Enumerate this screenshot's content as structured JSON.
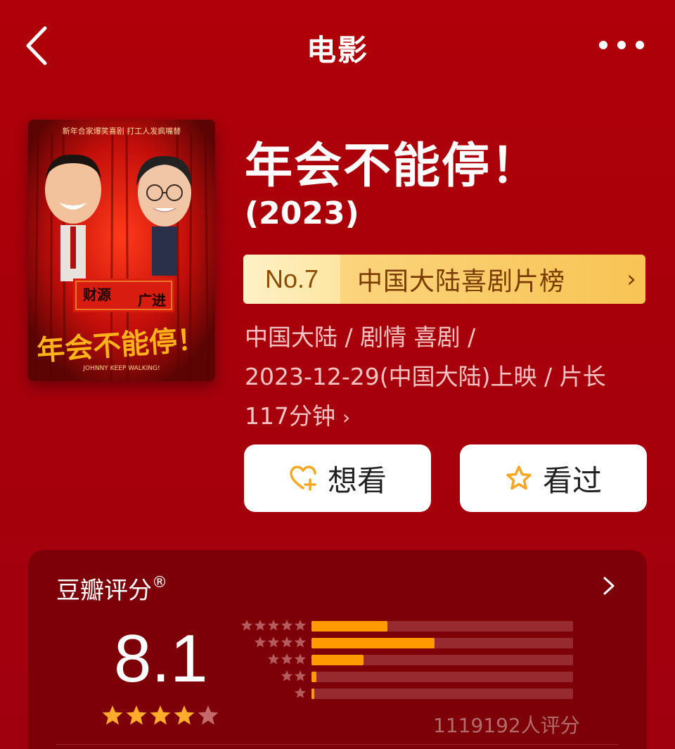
{
  "nav": {
    "title": "电影"
  },
  "movie": {
    "title": "年会不能停！",
    "year": "(2023)",
    "poster": {
      "tagline": "新年合家爆笑喜剧 打工人发疯嘴替",
      "sign_left": "财源",
      "sign_right": "广进",
      "title_art": "年会不能停！",
      "subtitle_art": "JOHNNY KEEP WALKING!"
    },
    "rank": {
      "no": "No.7",
      "label": "中国大陆喜剧片榜",
      "chevron": "›"
    },
    "meta": {
      "line1": "中国大陆 / 剧情 喜剧 /",
      "line2": "2023-12-29(中国大陆)上映 / 片长",
      "line3": "117分钟",
      "chevron": "›"
    },
    "actions": {
      "want_label": "想看",
      "want_icon": "heart-plus-icon",
      "seen_label": "看过",
      "seen_icon": "star-outline-icon"
    }
  },
  "rating": {
    "title": "豆瓣评分",
    "registered_mark": "®",
    "score": "8.1",
    "score_stars": 4,
    "distribution": [
      {
        "stars": 5,
        "fraction": 0.29
      },
      {
        "stars": 4,
        "fraction": 0.47
      },
      {
        "stars": 3,
        "fraction": 0.2
      },
      {
        "stars": 2,
        "fraction": 0.02
      },
      {
        "stars": 1,
        "fraction": 0.005
      }
    ],
    "count_text": "1119192人评分"
  },
  "colors": {
    "background": "#b00009",
    "card": "#7d0008",
    "accent_orange": "#ff9a00",
    "star_filled": "#ffac2d",
    "star_empty": "#c46a6c",
    "rank_gold": "#f8c454"
  }
}
